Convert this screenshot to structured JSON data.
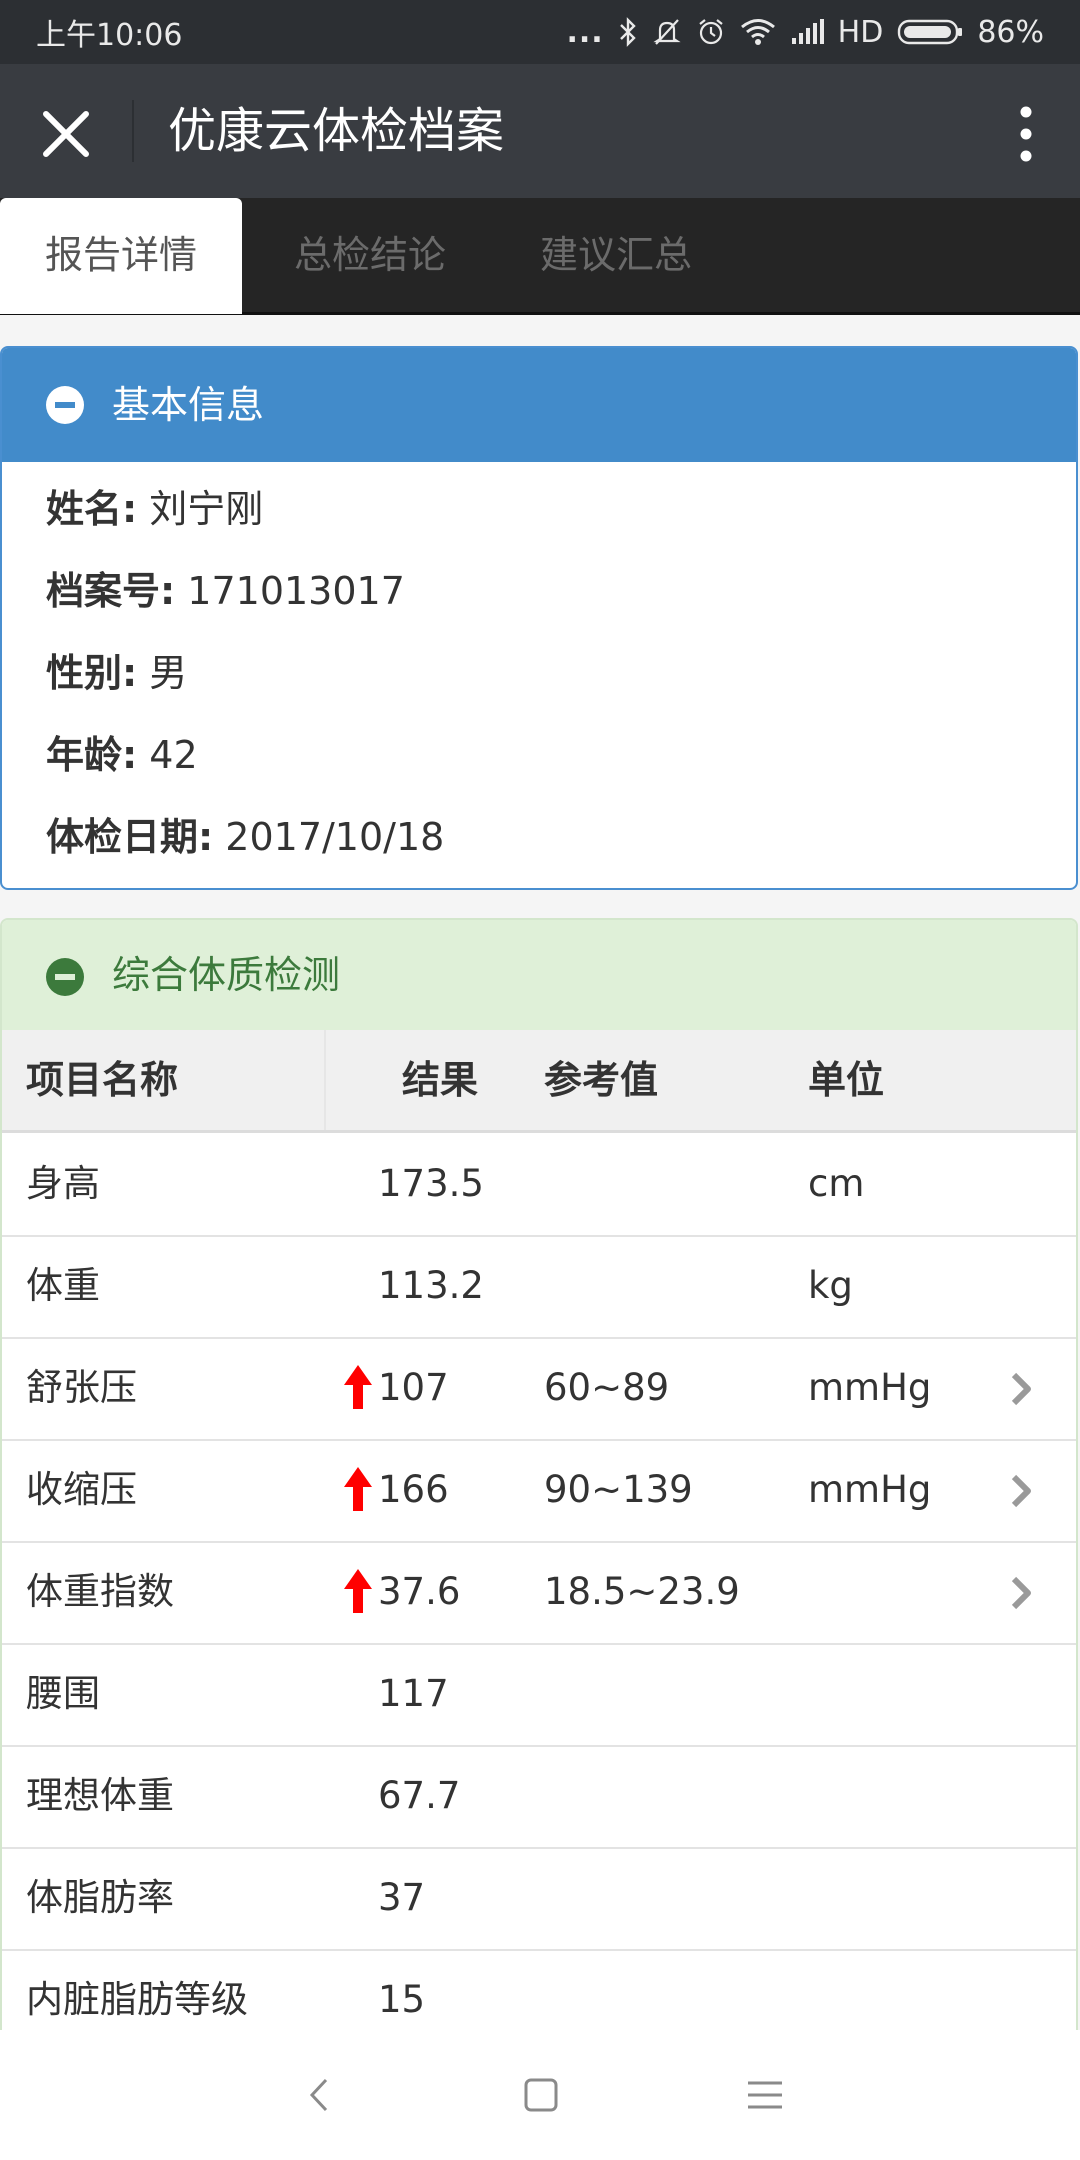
{
  "status_bar": {
    "time": "上午10:06",
    "dots": "...",
    "network": "HD",
    "battery": "86%"
  },
  "app_bar": {
    "title": "优康云体检档案"
  },
  "tabs": [
    {
      "label": "报告详情",
      "active": true
    },
    {
      "label": "总检结论",
      "active": false
    },
    {
      "label": "建议汇总",
      "active": false
    }
  ],
  "basic_info": {
    "title": "基本信息",
    "rows": [
      {
        "label": "姓名:",
        "value": "刘宁刚"
      },
      {
        "label": "档案号:",
        "value": "171013017"
      },
      {
        "label": "性别:",
        "value": "男"
      },
      {
        "label": "年龄:",
        "value": "42"
      },
      {
        "label": "体检日期:",
        "value": "2017/10/18"
      }
    ]
  },
  "physique": {
    "title": "综合体质检测",
    "headers": {
      "name": "项目名称",
      "result": "结果",
      "reference": "参考值",
      "unit": "单位"
    },
    "rows": [
      {
        "name": "身高",
        "result": "173.5",
        "reference": "",
        "unit": "cm",
        "abnormal": false,
        "detail": false
      },
      {
        "name": "体重",
        "result": "113.2",
        "reference": "",
        "unit": "kg",
        "abnormal": false,
        "detail": false
      },
      {
        "name": "舒张压",
        "result": "107",
        "reference": "60~89",
        "unit": "mmHg",
        "abnormal": true,
        "detail": true
      },
      {
        "name": "收缩压",
        "result": "166",
        "reference": "90~139",
        "unit": "mmHg",
        "abnormal": true,
        "detail": true
      },
      {
        "name": "体重指数",
        "result": "37.6",
        "reference": "18.5~23.9",
        "unit": "",
        "abnormal": true,
        "detail": true
      },
      {
        "name": "腰围",
        "result": "117",
        "reference": "",
        "unit": "",
        "abnormal": false,
        "detail": false
      },
      {
        "name": "理想体重",
        "result": "67.7",
        "reference": "",
        "unit": "",
        "abnormal": false,
        "detail": false
      },
      {
        "name": "体脂肪率",
        "result": "37",
        "reference": "",
        "unit": "",
        "abnormal": false,
        "detail": false
      },
      {
        "name": "内脏脂肪等级",
        "result": "15",
        "reference": "",
        "unit": "",
        "abnormal": false,
        "detail": false
      }
    ]
  },
  "colors": {
    "status_bar": "#2c2f33",
    "app_bar": "#393c41",
    "tab_bar": "#252525",
    "basic_header": "#428bca",
    "physique_header": "#dff0d8",
    "physique_title": "#3c7a3c",
    "abnormal_arrow": "#ff0000"
  },
  "icons": {
    "close": "close-icon",
    "more": "more-vertical-icon",
    "collapse": "minus-circle-icon",
    "abnormal": "arrow-up-icon",
    "detail": "chevron-right-icon",
    "nav_back": "back-icon",
    "nav_home": "home-icon",
    "nav_menu": "menu-icon"
  }
}
